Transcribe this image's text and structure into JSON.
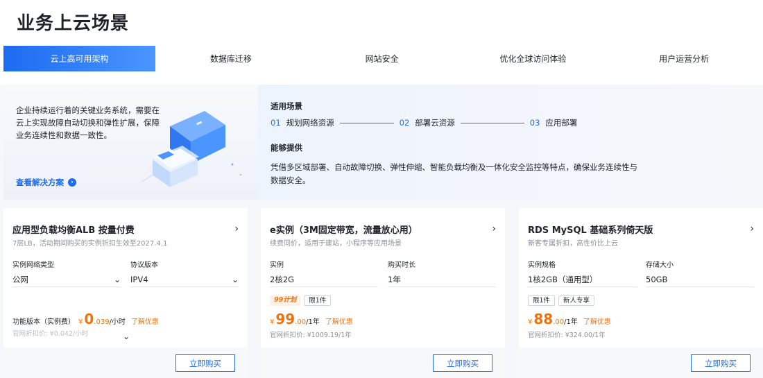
{
  "header": {
    "title": "业务上云场景"
  },
  "tabs": [
    {
      "label": "云上高可用架构",
      "active": true
    },
    {
      "label": "数据库迁移"
    },
    {
      "label": "网站安全"
    },
    {
      "label": "优化全球访问体验"
    },
    {
      "label": "用户运营分析"
    }
  ],
  "hero": {
    "description": "企业持续运行着的关键业务系统，需要在云上实现故障自动切换和弹性扩展，保障业务连续性和数据一致性。",
    "link_label": "查看解决方案",
    "scenario_title": "适用场景",
    "steps": [
      {
        "num": "01",
        "label": "规划网络资源"
      },
      {
        "num": "02",
        "label": "部署云资源"
      },
      {
        "num": "03",
        "label": "应用部署"
      }
    ],
    "capability_title": "能够提供",
    "capability_text": "凭借多区域部署、自动故障切换、弹性伸缩、智能负载均衡及一体化安全监控等特点，确保业务连续性与数据安全。"
  },
  "cards": [
    {
      "title": "应用型负载均衡ALB 按量付费",
      "subtitle": "7层LB，活动期间购买的实例折扣生效至2027.4.1",
      "field1_label": "实例网络类型",
      "field1_value": "公网",
      "field2_label": "协议版本",
      "field2_value": "IPV4",
      "price_label": "功能版本（实例费）",
      "currency": "¥",
      "price_int": "0",
      "price_dec": ".039",
      "unit": "/小时",
      "promo_link": "了解优惠",
      "orig_price": "官网折扣价: ¥0.042/小时",
      "buy_label": "立即购买"
    },
    {
      "title": "e实例（3M固定带宽，流量放心用）",
      "subtitle": "续费同价，适用于建站，小程序等应用场景",
      "field1_label": "实例",
      "field1_value": "2核2G",
      "field2_label": "购买时长",
      "field2_value": "1年",
      "tags": [
        "99计划",
        "限1件"
      ],
      "currency": "¥",
      "price_int": "99",
      "price_dec": ".00",
      "unit": "/1年",
      "promo_link": "了解优惠",
      "orig_price": "官网折扣价: ¥1009.19/1年",
      "buy_label": "立即购买"
    },
    {
      "title": "RDS MySQL 基础系列倚天版",
      "subtitle": "新客专属折扣，高性价比上云",
      "field1_label": "实例规格",
      "field1_value": "1核2GB（通用型）",
      "field2_label": "存储大小",
      "field2_value": "50GB",
      "tags": [
        "限1件",
        "新人专享"
      ],
      "currency": "¥",
      "price_int": "88",
      "price_dec": ".00",
      "unit": "/1年",
      "promo_link": "了解优惠",
      "orig_price": "官网折扣价: ¥324.00/1年",
      "buy_label": "立即购买"
    }
  ],
  "colors": {
    "accent": "#1d6bf0",
    "price": "#f2730e",
    "background": "#f5f7fa"
  }
}
